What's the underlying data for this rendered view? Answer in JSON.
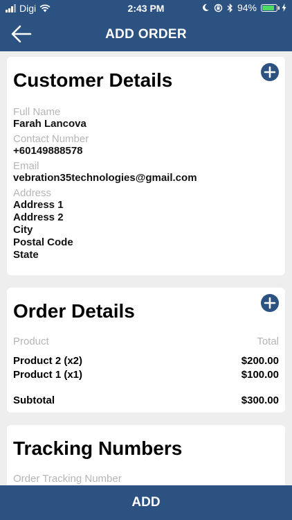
{
  "status_bar": {
    "carrier": "Digi",
    "time": "2:43 PM",
    "battery_percent": "94%",
    "battery_level": 0.94
  },
  "nav": {
    "title": "ADD ORDER",
    "back_icon": "arrow-left-icon"
  },
  "customer": {
    "title": "Customer Details",
    "add_icon": "plus-circle-icon",
    "fields": [
      {
        "label": "Full Name",
        "value": "Farah Lancova"
      },
      {
        "label": "Contact Number",
        "value": "+60149888578"
      },
      {
        "label": "Email",
        "value": "vebration35technologies@gmail.com"
      }
    ],
    "address_label": "Address",
    "address_lines": [
      "Address 1",
      "Address 2",
      "City",
      "Postal Code",
      "State"
    ]
  },
  "order": {
    "title": "Order Details",
    "add_icon": "plus-circle-icon",
    "col_product": "Product",
    "col_total": "Total",
    "items": [
      {
        "name": "Product 2 (x2)",
        "total": "$200.00"
      },
      {
        "name": "Product 1 (x1)",
        "total": "$100.00"
      }
    ],
    "subtotal_label": "Subtotal",
    "subtotal_value": "$300.00"
  },
  "tracking": {
    "title": "Tracking Numbers",
    "field_label": "Order Tracking Number"
  },
  "bottom_button": {
    "label": "ADD"
  },
  "colors": {
    "primary": "#2c5282",
    "background": "#eeeeee",
    "card": "#ffffff",
    "label_gray": "#b5b5b5"
  }
}
